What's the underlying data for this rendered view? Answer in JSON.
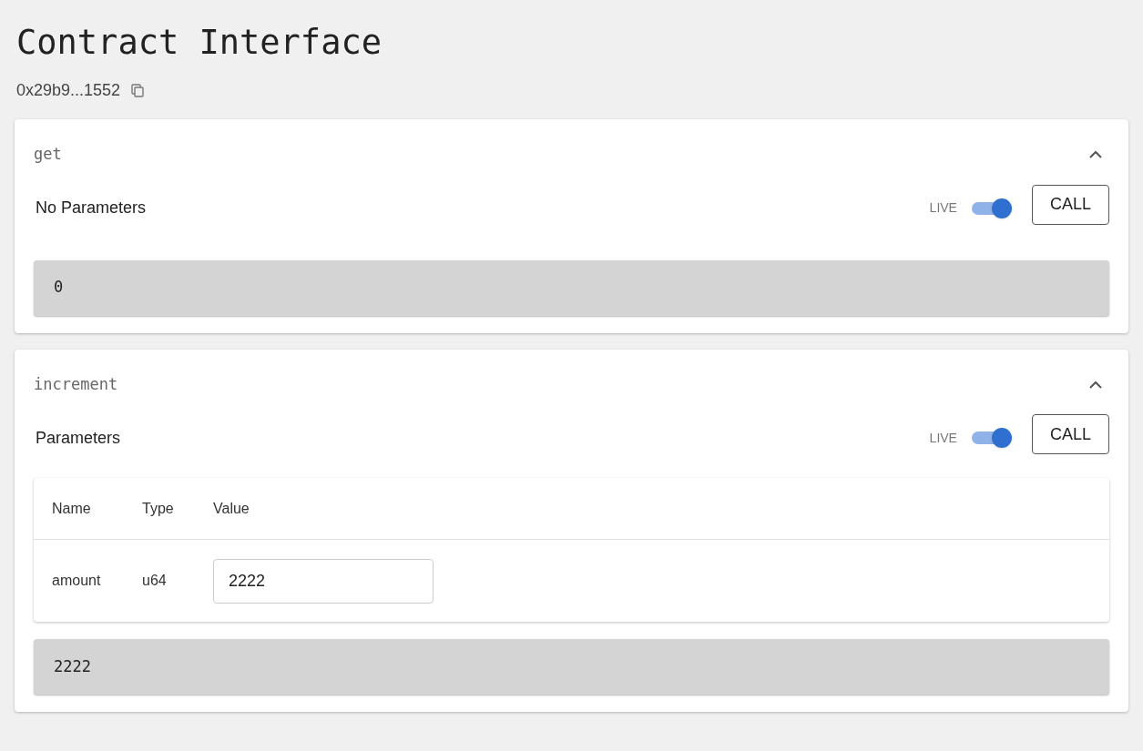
{
  "header": {
    "title": "Contract Interface",
    "address": "0x29b9...1552"
  },
  "methods": [
    {
      "name": "get",
      "expanded": true,
      "params_label": "No Parameters",
      "live_label": "LIVE",
      "live": true,
      "call_label": "CALL",
      "output": "0"
    },
    {
      "name": "increment",
      "expanded": true,
      "params_label": "Parameters",
      "live_label": "LIVE",
      "live": true,
      "call_label": "CALL",
      "table": {
        "columns": [
          "Name",
          "Type",
          "Value"
        ],
        "rows": [
          {
            "name": "amount",
            "type": "u64",
            "value": "2222"
          }
        ]
      },
      "output": "2222"
    }
  ]
}
